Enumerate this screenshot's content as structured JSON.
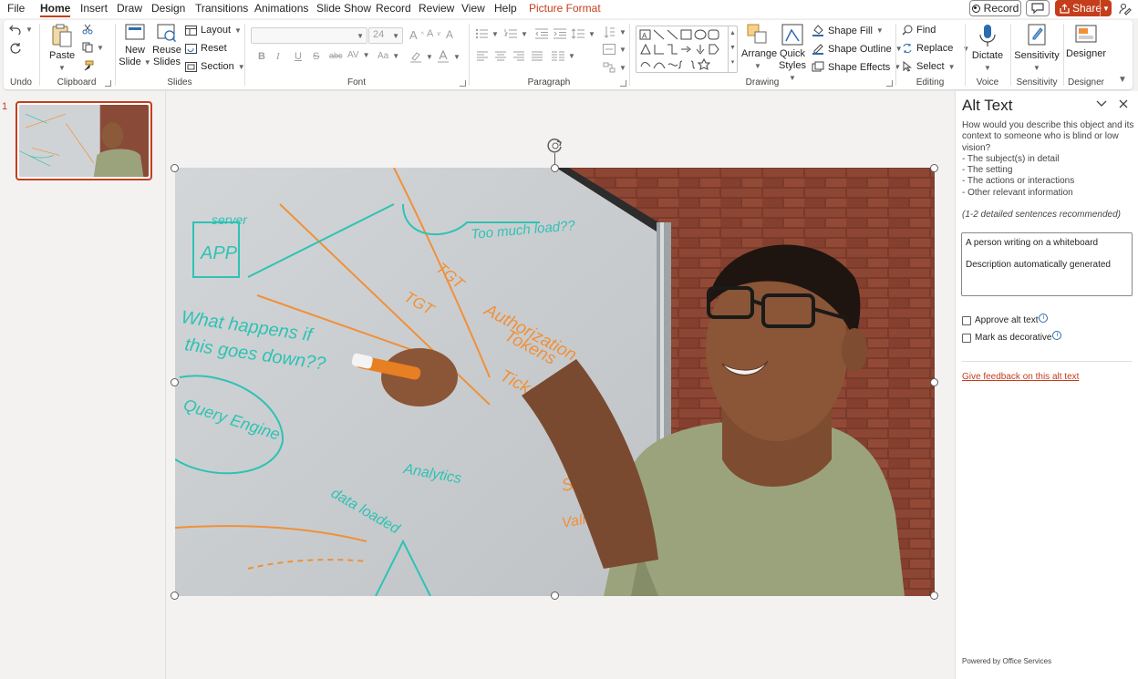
{
  "menu": {
    "tabs": [
      "File",
      "Home",
      "Insert",
      "Draw",
      "Design",
      "Transitions",
      "Animations",
      "Slide Show",
      "Record",
      "Review",
      "View",
      "Help",
      "Picture Format"
    ],
    "active_tab": "Home",
    "record_label": "Record",
    "share_label": "Share"
  },
  "ribbon": {
    "undo": {
      "label": "Undo"
    },
    "clipboard": {
      "label": "Clipboard",
      "paste": "Paste"
    },
    "slides": {
      "label": "Slides",
      "new_slide_1": "New",
      "new_slide_2": "Slide",
      "reuse_1": "Reuse",
      "reuse_2": "Slides",
      "layout": "Layout",
      "reset": "Reset",
      "section": "Section"
    },
    "font": {
      "label": "Font",
      "font_name": "",
      "font_size": "24",
      "bold": "B",
      "italic": "I",
      "underline": "U",
      "strike": "S",
      "shadow": "abc",
      "spacing": "AV",
      "case": "Aa",
      "grow": "A",
      "shrink": "A",
      "clear": "A"
    },
    "paragraph": {
      "label": "Paragraph"
    },
    "drawing": {
      "label": "Drawing",
      "arrange": "Arrange",
      "quick_1": "Quick",
      "quick_2": "Styles",
      "shape_fill": "Shape Fill",
      "shape_outline": "Shape Outline",
      "shape_effects": "Shape Effects"
    },
    "editing": {
      "label": "Editing",
      "find": "Find",
      "replace": "Replace",
      "select": "Select"
    },
    "voice": {
      "label": "Voice",
      "dictate": "Dictate"
    },
    "sensitivity": {
      "label": "Sensitivity",
      "button": "Sensitivity"
    },
    "designer": {
      "label": "Designer",
      "button": "Designer"
    }
  },
  "slides_panel": {
    "slide_number": "1"
  },
  "whiteboard_words": [
    "APP",
    "server",
    "What happens if",
    "this goes down??",
    "Query Engine",
    "Too much load??",
    "Authorization",
    "Tokens",
    "Ticket cache",
    "Analytics",
    "data loaded",
    "SSO",
    "Validation",
    "TGT",
    "TGT"
  ],
  "alt_text_pane": {
    "title": "Alt Text",
    "description_lines": [
      "How would you describe this object and its",
      "context to someone who is blind or low",
      "vision?",
      "- The subject(s) in detail",
      "- The setting",
      "- The actions or interactions",
      "- Other relevant information"
    ],
    "recommendation": "(1-2 detailed sentences recommended)",
    "alt_text_value": "A person writing on a whiteboard\n\nDescription automatically generated",
    "approve_label": "Approve alt text",
    "decorative_label": "Mark as decorative",
    "feedback_link": "Give feedback on this alt text",
    "powered_by": "Powered by Office Services"
  },
  "colors": {
    "accent": "#c43e1c",
    "teal_marker": "#2fc2b4",
    "orange_marker": "#f0903a",
    "shirt": "#9aa37c",
    "brick": "#7a3a2a"
  }
}
